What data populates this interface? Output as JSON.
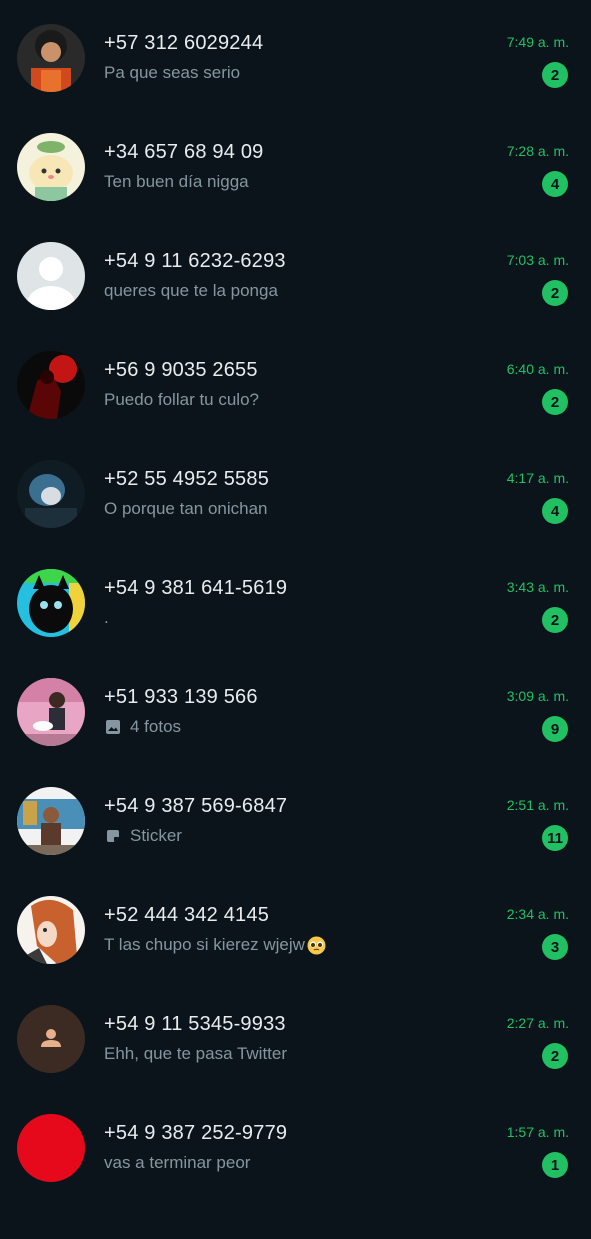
{
  "colors": {
    "background": "#0b141a",
    "accent_green": "#21c063",
    "name_text": "#e9edef",
    "preview_text": "#8696a0"
  },
  "chats": [
    {
      "name": "+57 312 6029244",
      "preview": "Pa que seas serio",
      "time": "7:49 a. m.",
      "unread": "2",
      "avatar": "photo-person-red-shirt"
    },
    {
      "name": "+34 657 68 94 09",
      "preview": "Ten buen día nigga",
      "time": "7:28 a. m.",
      "unread": "4",
      "avatar": "cartoon-character-green-hat"
    },
    {
      "name": "+54 9 11 6232-6293",
      "preview": "queres que te la ponga",
      "time": "7:03 a. m.",
      "unread": "2",
      "avatar": "default-avatar-grey"
    },
    {
      "name": "+56 9 9035 2655",
      "preview": "Puedo follar tu culo?",
      "time": "6:40 a. m.",
      "unread": "2",
      "avatar": "dark-red-figure"
    },
    {
      "name": "+52 55 4952 5585",
      "preview": "O porque tan onichan",
      "time": "4:17 a. m.",
      "unread": "4",
      "avatar": "blue-hooded-figure"
    },
    {
      "name": "+54 9 381 641-5619",
      "preview": ".",
      "time": "3:43 a. m.",
      "unread": "2",
      "avatar": "black-cat-colorful"
    },
    {
      "name": "+51 933 139 566",
      "preview": "4 fotos",
      "preview_icon": "photo-icon",
      "time": "3:09 a. m.",
      "unread": "9",
      "avatar": "pink-room-photo"
    },
    {
      "name": "+54 9 387 569-6847",
      "preview": "Sticker",
      "preview_icon": "sticker-icon",
      "time": "2:51 a. m.",
      "unread": "11",
      "avatar": "meme-man-photo"
    },
    {
      "name": "+52 444 342 4145",
      "preview": "T las chupo si kierez wjejw",
      "preview_emoji": "pleading-face-emoji",
      "time": "2:34 a. m.",
      "unread": "3",
      "avatar": "anime-orange-hair"
    },
    {
      "name": "+54 9 11 5345-9933",
      "preview": "Ehh, que te pasa Twitter",
      "time": "2:27 a. m.",
      "unread": "2",
      "avatar": "default-avatar-brown"
    },
    {
      "name": "+54 9 387 252-9779",
      "preview": "vas a terminar peor",
      "time": "1:57 a. m.",
      "unread": "1",
      "avatar": "solid-red-circle"
    }
  ]
}
